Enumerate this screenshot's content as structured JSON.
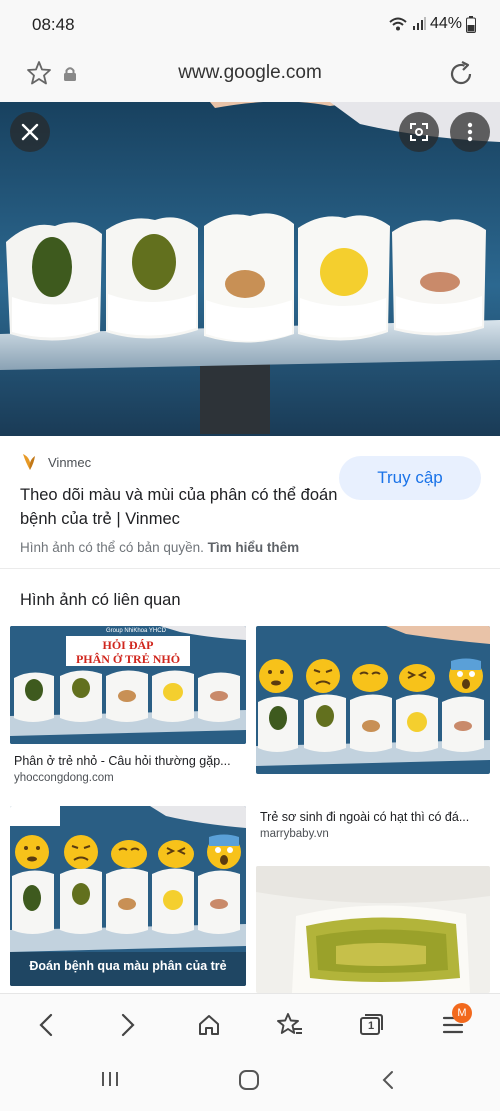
{
  "status_bar": {
    "time": "08:48",
    "battery": "44%"
  },
  "browser": {
    "url": "www.google.com"
  },
  "result": {
    "source": "Vinmec",
    "title": "Theo dõi màu và mùi của phân có thể đoán bệnh của trẻ | Vinmec",
    "visit_label": "Truy cập",
    "copyright_text": "Hình ảnh có thể có bản quyền.",
    "learn_more": "Tìm hiểu thêm"
  },
  "related": {
    "heading": "Hình ảnh có liên quan",
    "items": [
      {
        "caption": "Phân ở trẻ nhỏ - Câu hỏi thường gặp...",
        "domain": "yhoccongdong.com",
        "overlay_small": "Group NhiKhoa YHCD",
        "overlay_line1": "HỎI ĐÁP",
        "overlay_line2": "PHÂN Ở TRẺ NHỎ"
      },
      {
        "caption": "Trẻ sơ sinh đi ngoài có hạt thì có đá...",
        "domain": "marrybaby.vn"
      },
      {
        "overlay_caption": "Đoán bệnh qua màu phân của trẻ"
      },
      {}
    ]
  },
  "colors": {
    "accent": "#1a73e8",
    "visit_bg": "#e8f0fe",
    "badge": "#f2691d"
  },
  "bottom_nav": {
    "tabs_count": "1",
    "menu_badge": "M"
  }
}
